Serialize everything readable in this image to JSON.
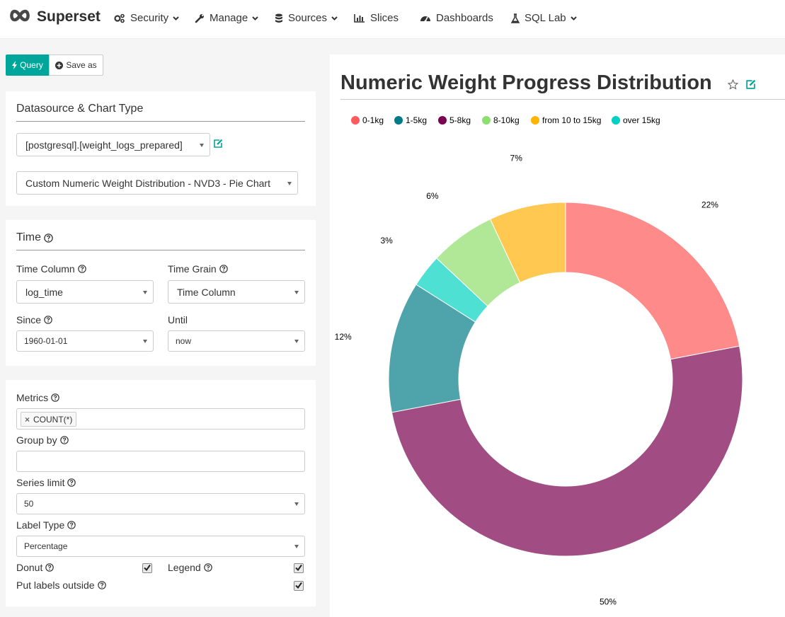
{
  "nav": {
    "brand": "Superset",
    "items": [
      {
        "label": "Security",
        "dropdown": true
      },
      {
        "label": "Manage",
        "dropdown": true
      },
      {
        "label": "Sources",
        "dropdown": true
      },
      {
        "label": "Slices",
        "dropdown": false
      },
      {
        "label": "Dashboards",
        "dropdown": false
      },
      {
        "label": "SQL Lab",
        "dropdown": true
      }
    ]
  },
  "toolbar": {
    "query_label": "Query",
    "save_label": "Save as"
  },
  "datasource_panel": {
    "title": "Datasource & Chart Type",
    "datasource": "[postgresql].[weight_logs_prepared]",
    "chart_type": "Custom Numeric Weight Distribution - NVD3 - Pie Chart"
  },
  "time_panel": {
    "title": "Time",
    "time_column_label": "Time Column",
    "time_column_value": "log_time",
    "time_grain_label": "Time Grain",
    "time_grain_value": "Time Column",
    "since_label": "Since",
    "since_value": "1960-01-01",
    "until_label": "Until",
    "until_value": "now"
  },
  "query_panel": {
    "metrics_label": "Metrics",
    "metric_tag": "COUNT(*)",
    "group_by_label": "Group by",
    "group_by_value": "",
    "series_limit_label": "Series limit",
    "series_limit_value": "50",
    "label_type_label": "Label Type",
    "label_type_value": "Percentage",
    "donut_label": "Donut",
    "donut_checked": true,
    "legend_label": "Legend",
    "legend_checked": true,
    "labels_outside_label": "Put labels outside",
    "labels_outside_checked": true
  },
  "chart": {
    "title": "Numeric Weight Progress Distribution"
  },
  "colors": {
    "accent": "#00a699"
  },
  "chart_data": {
    "type": "pie",
    "donut": true,
    "label_type": "percentage",
    "legend_position": "top-left",
    "slices": [
      {
        "name": "0-1kg",
        "value": 22,
        "label": "22%",
        "color": "#ff8a8a",
        "legend_color": "#ff5a5f"
      },
      {
        "name": "5-8kg",
        "value": 50,
        "label": "50%",
        "color": "#a14d83",
        "legend_color": "#7b0051"
      },
      {
        "name": "1-5kg",
        "value": 12,
        "label": "12%",
        "color": "#4fa3ab",
        "legend_color": "#007a87"
      },
      {
        "name": "over 15kg",
        "value": 3,
        "label": "3%",
        "color": "#4fe0d4",
        "legend_color": "#00d1c1"
      },
      {
        "name": "8-10kg",
        "value": 6,
        "label": "6%",
        "color": "#b0e898",
        "legend_color": "#8ce071"
      },
      {
        "name": "from 10 to 15kg",
        "value": 7,
        "label": "7%",
        "color": "#ffc850",
        "legend_color": "#ffb400"
      }
    ],
    "legend_order": [
      "0-1kg",
      "1-5kg",
      "5-8kg",
      "8-10kg",
      "from 10 to 15kg",
      "over 15kg"
    ]
  }
}
